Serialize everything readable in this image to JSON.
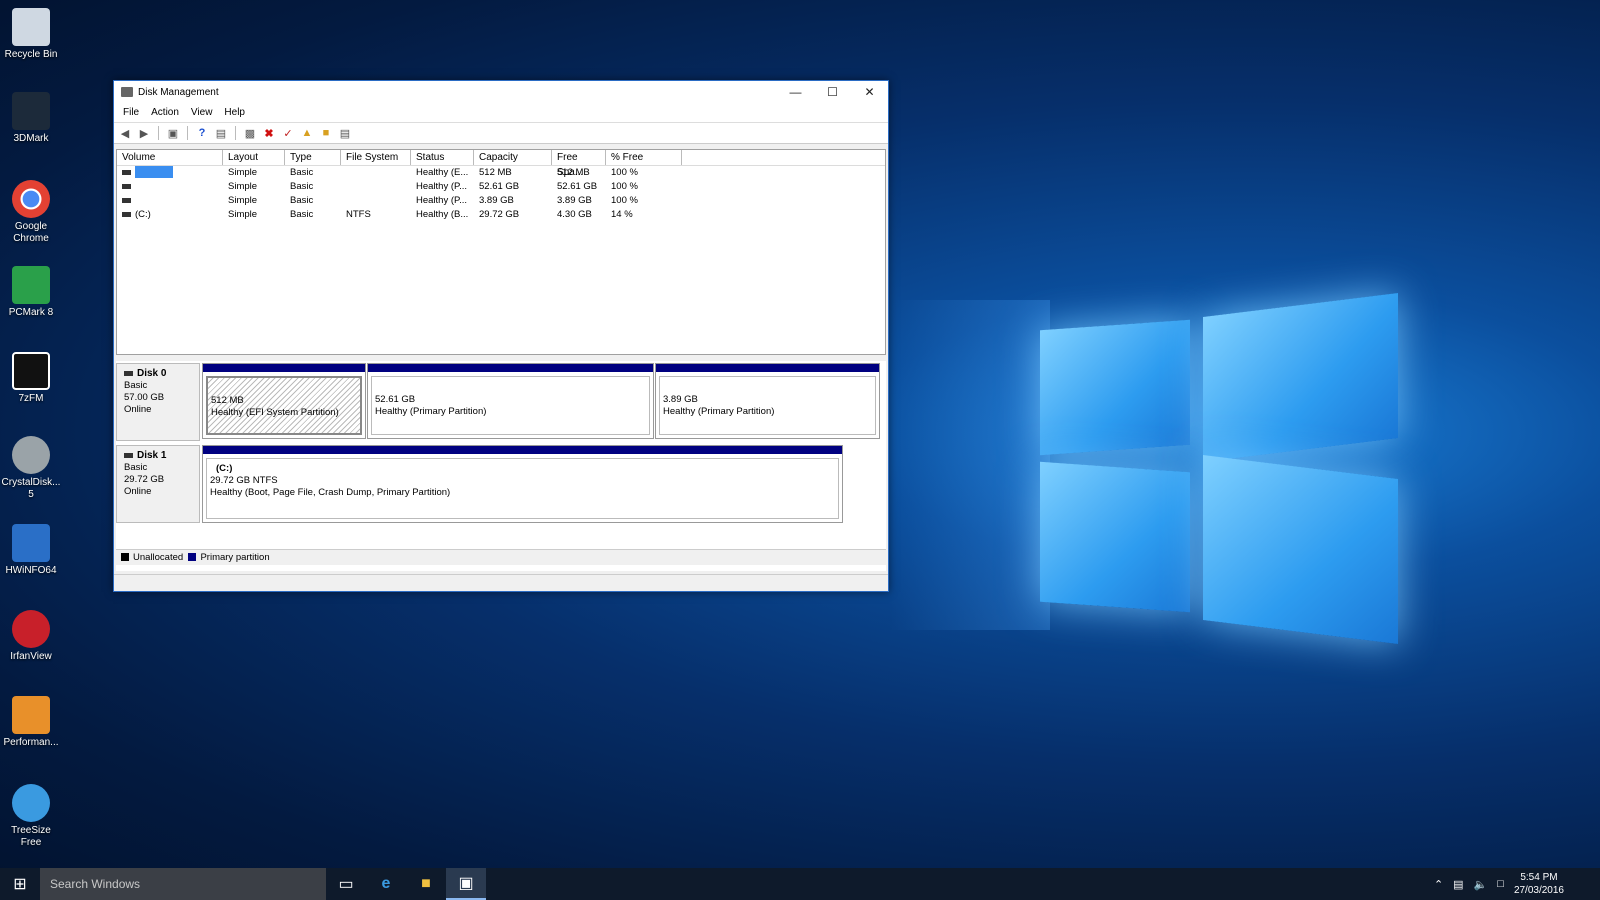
{
  "desktop_icons": [
    {
      "label": "Recycle Bin",
      "color": "#cfd8e2"
    },
    {
      "label": "3DMark",
      "color": "#1c2a3a"
    },
    {
      "label": "Google Chrome",
      "color": "#e34133"
    },
    {
      "label": "PCMark 8",
      "color": "#2aa04a"
    },
    {
      "label": "7zFM",
      "color": "#111111"
    },
    {
      "label": "CrystalDisk... 5",
      "color": "#9aa3a8"
    },
    {
      "label": "HWiNFO64",
      "color": "#2a6fc7"
    },
    {
      "label": "IrfanView",
      "color": "#c8202a"
    },
    {
      "label": "Performan...",
      "color": "#e8902a"
    },
    {
      "label": "TreeSize Free",
      "color": "#3a9ae0"
    }
  ],
  "window": {
    "title": "Disk Management",
    "menu": [
      "File",
      "Action",
      "View",
      "Help"
    ],
    "columns": [
      "Volume",
      "Layout",
      "Type",
      "File System",
      "Status",
      "Capacity",
      "Free Spa...",
      "% Free"
    ],
    "rows": [
      {
        "volume": "",
        "layout": "Simple",
        "type": "Basic",
        "fs": "",
        "status": "Healthy (E...",
        "capacity": "512 MB",
        "free": "512 MB",
        "pct": "100 %"
      },
      {
        "volume": "",
        "layout": "Simple",
        "type": "Basic",
        "fs": "",
        "status": "Healthy (P...",
        "capacity": "52.61 GB",
        "free": "52.61 GB",
        "pct": "100 %"
      },
      {
        "volume": "",
        "layout": "Simple",
        "type": "Basic",
        "fs": "",
        "status": "Healthy (P...",
        "capacity": "3.89 GB",
        "free": "3.89 GB",
        "pct": "100 %"
      },
      {
        "volume": "(C:)",
        "layout": "Simple",
        "type": "Basic",
        "fs": "NTFS",
        "status": "Healthy (B...",
        "capacity": "29.72 GB",
        "free": "4.30 GB",
        "pct": "14 %"
      }
    ],
    "disk0": {
      "name": "Disk 0",
      "type": "Basic",
      "size": "57.00 GB",
      "state": "Online",
      "p1_size": "512 MB",
      "p1_status": "Healthy (EFI System Partition)",
      "p2_size": "52.61 GB",
      "p2_status": "Healthy (Primary Partition)",
      "p3_size": "3.89 GB",
      "p3_status": "Healthy (Primary Partition)"
    },
    "disk1": {
      "name": "Disk 1",
      "type": "Basic",
      "size": "29.72 GB",
      "state": "Online",
      "p1_name": "(C:)",
      "p1_size": "29.72 GB NTFS",
      "p1_status": "Healthy (Boot, Page File, Crash Dump, Primary Partition)"
    },
    "legend": {
      "unallocated": "Unallocated",
      "primary": "Primary partition",
      "unallocated_color": "#000000",
      "primary_color": "#000080"
    }
  },
  "taskbar": {
    "search_placeholder": "Search Windows",
    "time": "5:54 PM",
    "date": "27/03/2016"
  }
}
